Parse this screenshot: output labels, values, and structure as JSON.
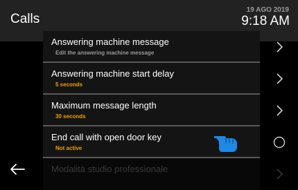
{
  "header": {
    "title": "Calls",
    "date": "19 AGO 2019",
    "time": "9:18 AM"
  },
  "rows": [
    {
      "title": "Answering machine message",
      "subtitle": "Edit the answering machine message",
      "action_icon": "chevron-right-icon"
    },
    {
      "title": "Answering machine start delay",
      "subtitle": "5 seconds",
      "action_icon": "chevron-right-icon"
    },
    {
      "title": "Maximum message length",
      "subtitle": "30 seconds",
      "action_icon": "chevron-right-icon"
    },
    {
      "title": "End call with open door key",
      "subtitle": "Not active",
      "action_icon": "radio-off-icon"
    },
    {
      "title": "Modalità studio professionale",
      "action_icon": "chevron-right-icon"
    }
  ],
  "nav": {
    "back_icon": "back-arrow-icon"
  },
  "colors": {
    "accent": "#f0a000",
    "hand": "#1e88e5"
  }
}
